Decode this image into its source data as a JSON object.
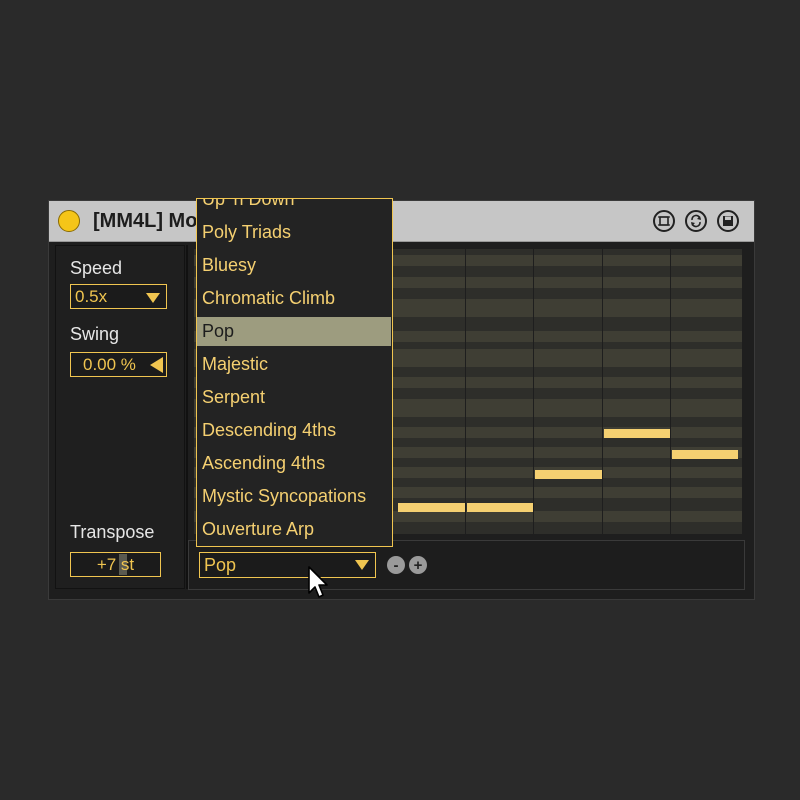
{
  "titlebar": {
    "title": "[MM4L] Mo",
    "icons": [
      "power-icon",
      "fit-icon",
      "refresh-icon",
      "save-icon"
    ]
  },
  "controls": {
    "speed_label": "Speed",
    "speed_value": "0.5x",
    "swing_label": "Swing",
    "swing_value": "0.00 %",
    "transpose_label": "Transpose",
    "transpose_value": "+7 st"
  },
  "dropdown": {
    "items": [
      "Up 'n Down",
      "Poly Triads",
      "Bluesy",
      "Chromatic Climb",
      "Pop",
      "Majestic",
      "Serpent",
      "Descending 4ths",
      "Ascending 4ths",
      "Mystic Syncopations",
      "Ouverture Arp"
    ],
    "selected": "Pop"
  },
  "pattern_select": {
    "value": "Pop",
    "minus_label": "-",
    "plus_label": "+"
  },
  "colors": {
    "accent": "#f0c550",
    "note": "#f5d071",
    "selected_item_bg": "#9d9c7f",
    "background": "#2a2a2a",
    "title_bar": "#c6c6c6"
  }
}
